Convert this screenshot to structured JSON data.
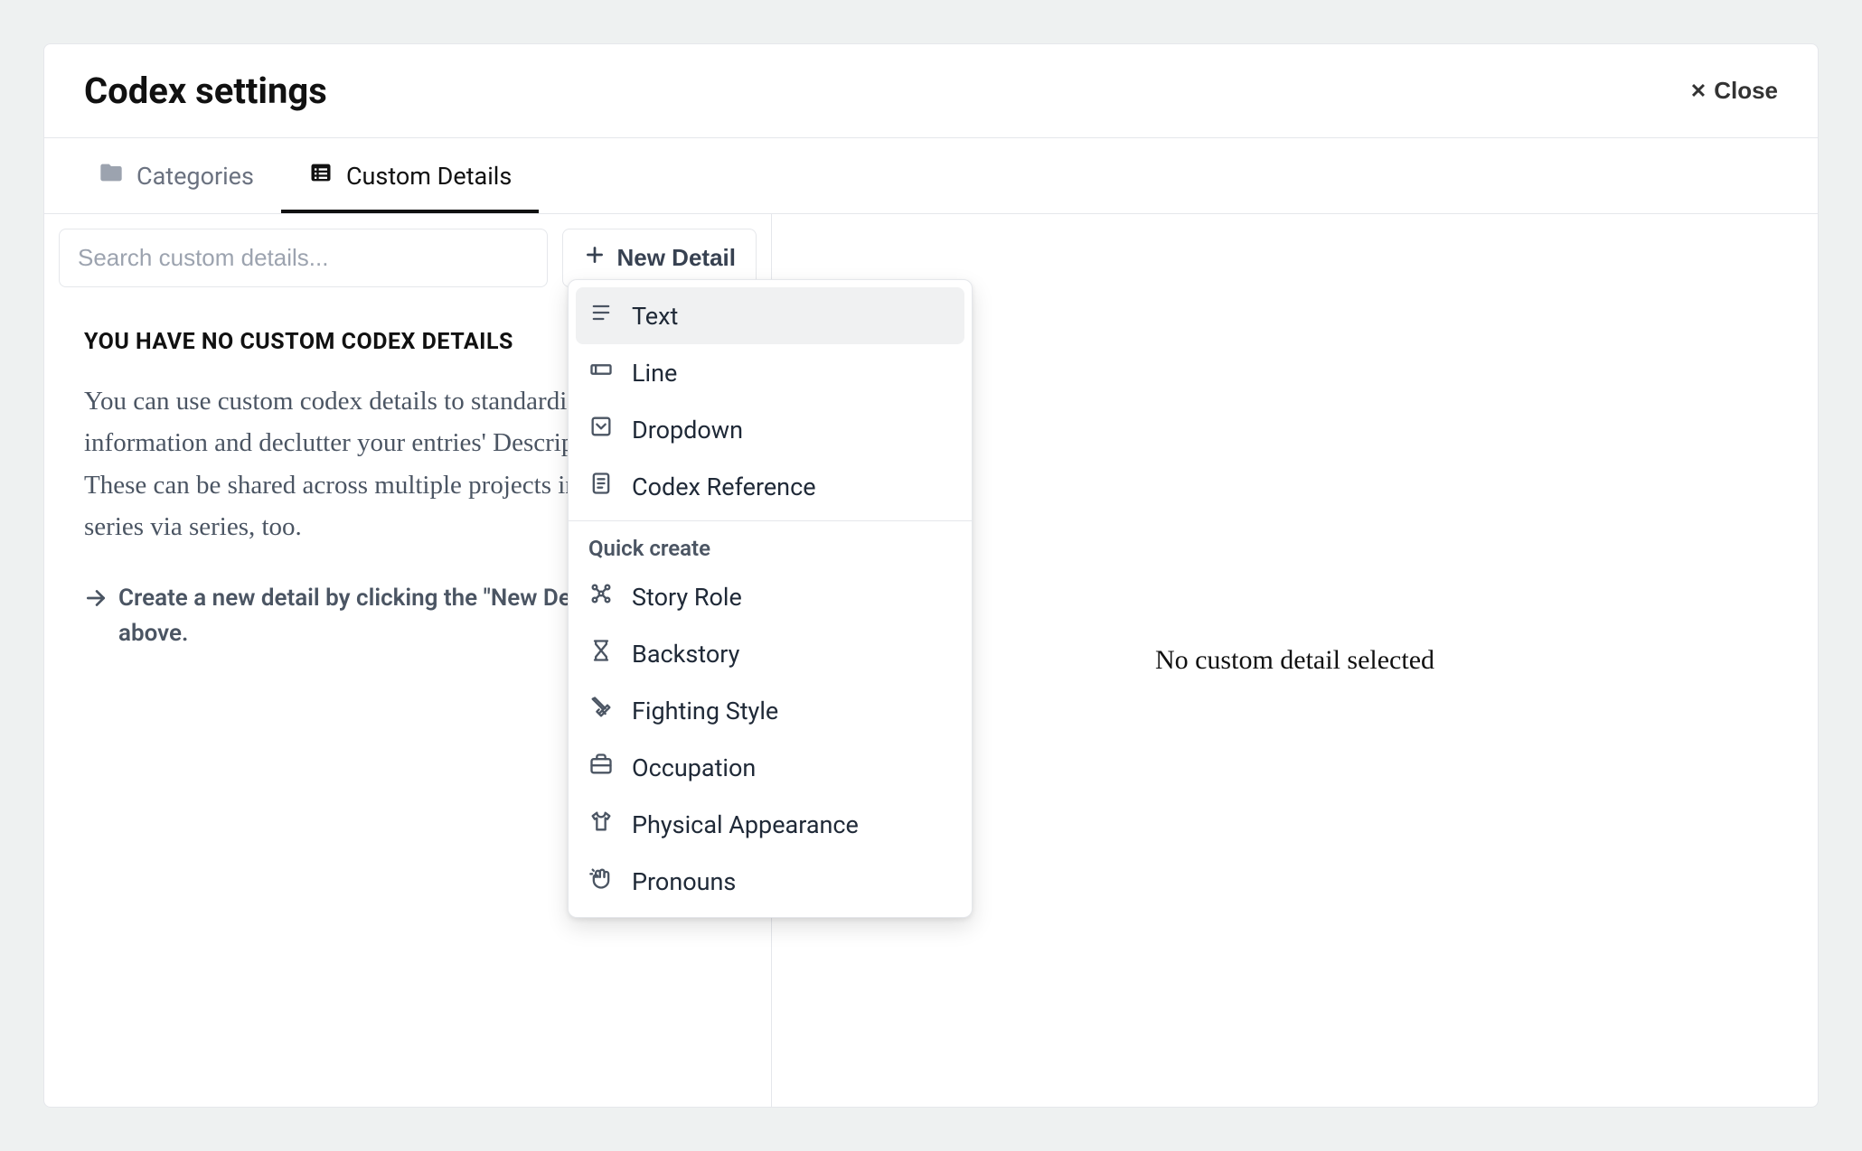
{
  "modal": {
    "title": "Codex settings",
    "close_label": "Close"
  },
  "tabs": {
    "categories": "Categories",
    "custom_details": "Custom Details"
  },
  "search": {
    "placeholder": "Search custom details..."
  },
  "new_detail": {
    "label": "New Detail"
  },
  "empty": {
    "heading": "YOU HAVE NO CUSTOM CODEX DETAILS",
    "body": "You can use custom codex details to standardise codex information and declutter your entries' Description fields. These can be shared across multiple projects in the same series via series, too.",
    "hint": "Create a new detail by clicking the \"New Detail\" button above."
  },
  "right_panel": {
    "empty_message": "No custom detail selected"
  },
  "dropdown": {
    "basic": [
      {
        "label": "Text",
        "icon": "text"
      },
      {
        "label": "Line",
        "icon": "line"
      },
      {
        "label": "Dropdown",
        "icon": "dropdown"
      },
      {
        "label": "Codex Reference",
        "icon": "codex"
      }
    ],
    "quick_label": "Quick create",
    "quick": [
      {
        "label": "Story Role",
        "icon": "story-role"
      },
      {
        "label": "Backstory",
        "icon": "backstory"
      },
      {
        "label": "Fighting Style",
        "icon": "fighting"
      },
      {
        "label": "Occupation",
        "icon": "occupation"
      },
      {
        "label": "Physical Appearance",
        "icon": "appearance"
      },
      {
        "label": "Pronouns",
        "icon": "pronouns"
      }
    ]
  }
}
